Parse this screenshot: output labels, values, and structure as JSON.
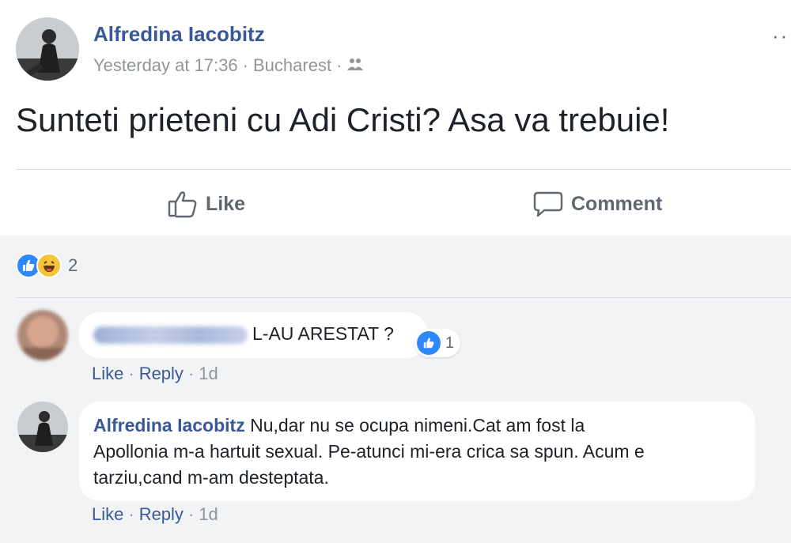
{
  "post": {
    "author": "Alfredina Iacobitz",
    "timestamp": "Yesterday at 17:36",
    "location": "Bucharest",
    "separator": "·",
    "audience_icon": "friends-icon",
    "more_label": "··",
    "text": "Sunteti prieteni cu Adi Cristi? Asa va trebuie!"
  },
  "actions": {
    "like_label": "Like",
    "comment_label": "Comment"
  },
  "reactions": {
    "icons": [
      "like-icon",
      "haha-icon"
    ],
    "count": "2"
  },
  "comments": [
    {
      "author": "",
      "author_blurred": true,
      "text": "L-AU ARESTAT ?",
      "like_count": "1",
      "like_label": "Like",
      "reply_label": "Reply",
      "age": "1d"
    },
    {
      "author": "Alfredina Iacobitz",
      "text_lines": [
        "Nu,dar nu se ocupa nimeni.Cat am fost la",
        "Apollonia m-a hartuit sexual. Pe-atunci mi-era crica sa spun. Acum e",
        "tarziu,cand m-am desteptata."
      ],
      "like_label": "Like",
      "reply_label": "Reply",
      "age": "1d"
    }
  ],
  "colors": {
    "link": "#385898",
    "meta": "#90949c",
    "comments_bg": "#f2f3f5",
    "like_blue": "#2d88ff",
    "haha_yellow": "#f7c33a"
  }
}
